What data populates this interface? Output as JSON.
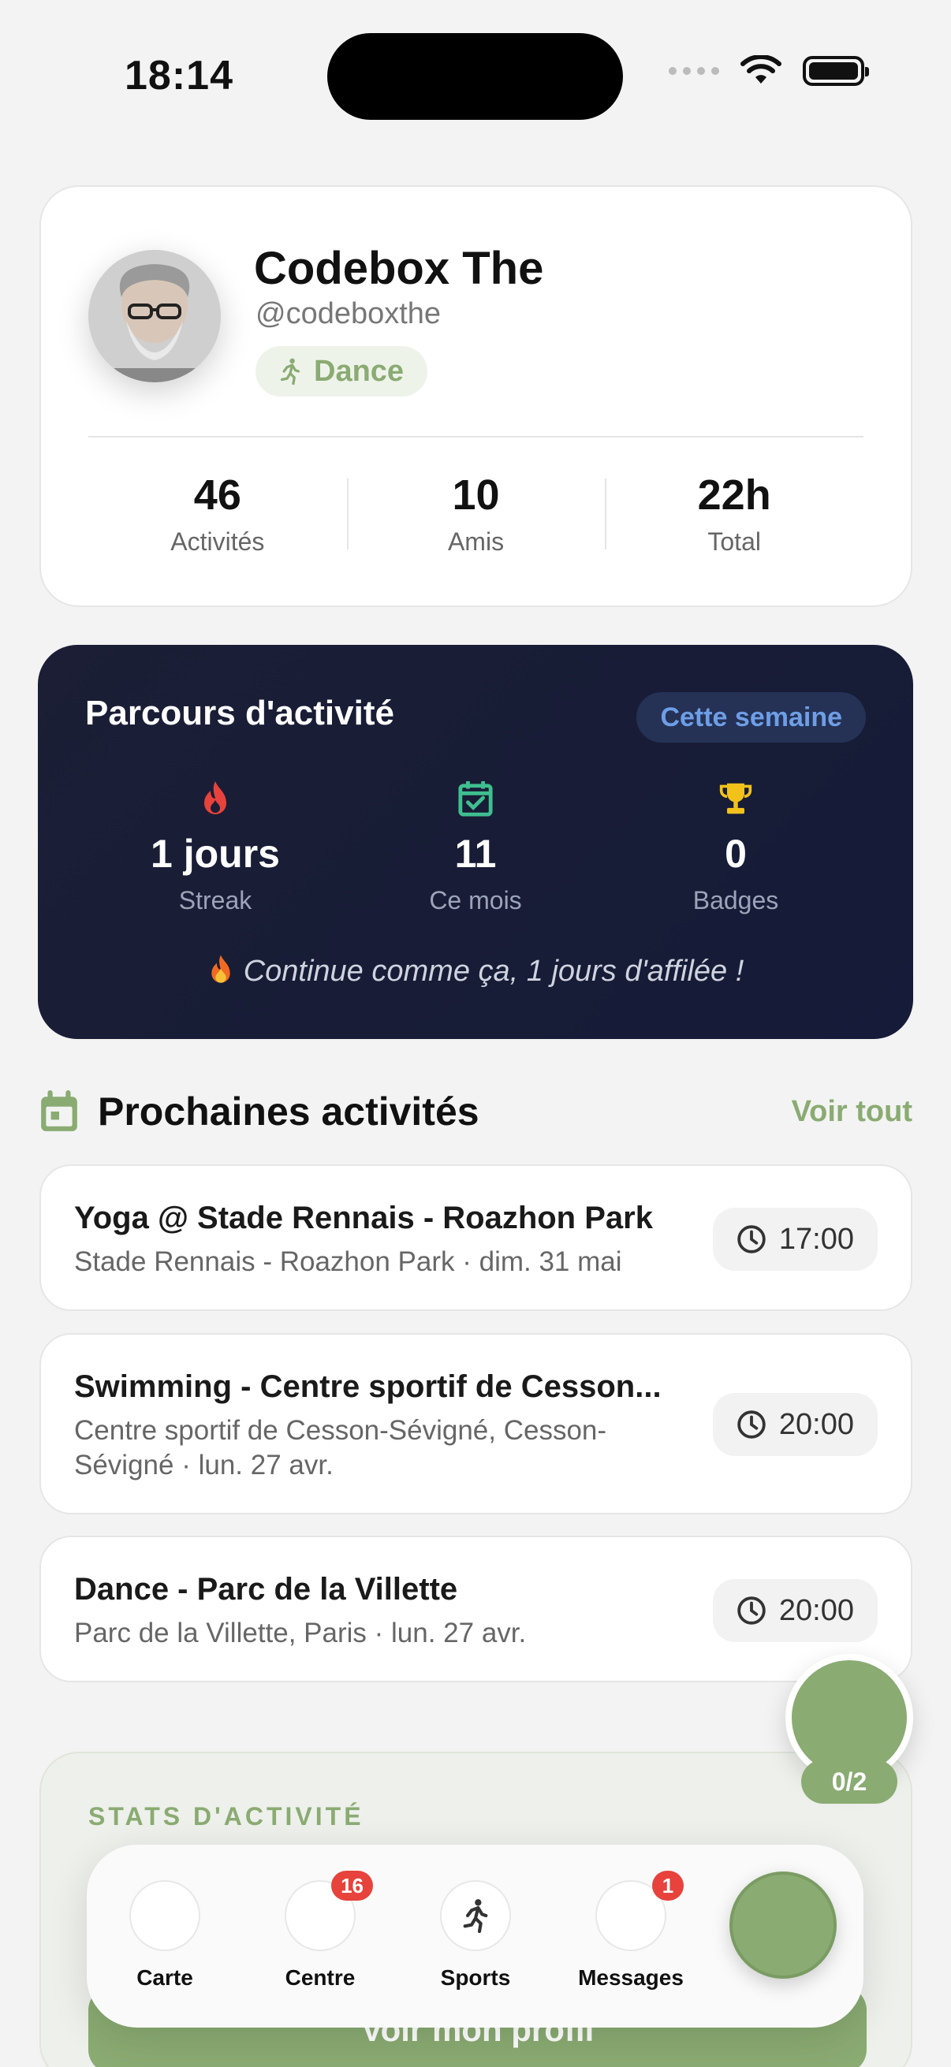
{
  "status_bar": {
    "time": "18:14"
  },
  "profile": {
    "name": "Codebox The",
    "handle": "@codeboxthe",
    "sport": "Dance",
    "stats": [
      {
        "value": "46",
        "label": "Activités"
      },
      {
        "value": "10",
        "label": "Amis"
      },
      {
        "value": "22h",
        "label": "Total"
      }
    ]
  },
  "journey": {
    "title": "Parcours d'activité",
    "period": "Cette semaine",
    "stats": [
      {
        "value": "1 jours",
        "label": "Streak",
        "icon": "flame-icon",
        "color": "#e8423c"
      },
      {
        "value": "11",
        "label": "Ce mois",
        "icon": "calendar-check-icon",
        "color": "#3fbf8f"
      },
      {
        "value": "0",
        "label": "Badges",
        "icon": "trophy-icon",
        "color": "#f2c21b"
      }
    ],
    "message": "Continue comme ça, 1 jours d'affilée !"
  },
  "upcoming": {
    "title": "Prochaines activités",
    "see_all": "Voir tout",
    "items": [
      {
        "title": "Yoga @ Stade Rennais - Roazhon Park",
        "subtitle": "Stade Rennais - Roazhon Park · dim. 31 mai",
        "time": "17:00"
      },
      {
        "title": "Swimming - Centre sportif de Cesson...",
        "subtitle_line1": "Centre sportif de Cesson-Sévigné, Cesson-",
        "subtitle_line2": "Sévigné · lun. 27 avr.",
        "time": "20:00"
      },
      {
        "title": "Dance - Parc de la Villette",
        "subtitle": "Parc de la Villette, Paris · lun. 27 avr.",
        "time": "20:00"
      }
    ]
  },
  "activity_stats": {
    "label": "STATS D'ACTIVITÉ",
    "button": "Voir mon profil"
  },
  "floating": {
    "count": "0/2"
  },
  "tabbar": {
    "tabs": [
      {
        "label": "Carte",
        "badge": ""
      },
      {
        "label": "Centre",
        "badge": "16"
      },
      {
        "label": "Sports",
        "badge": ""
      },
      {
        "label": "Messages",
        "badge": "1"
      }
    ]
  },
  "colors": {
    "accent": "#8aab72",
    "dark_card": "#1b1e35",
    "badge_red": "#e8423c"
  }
}
